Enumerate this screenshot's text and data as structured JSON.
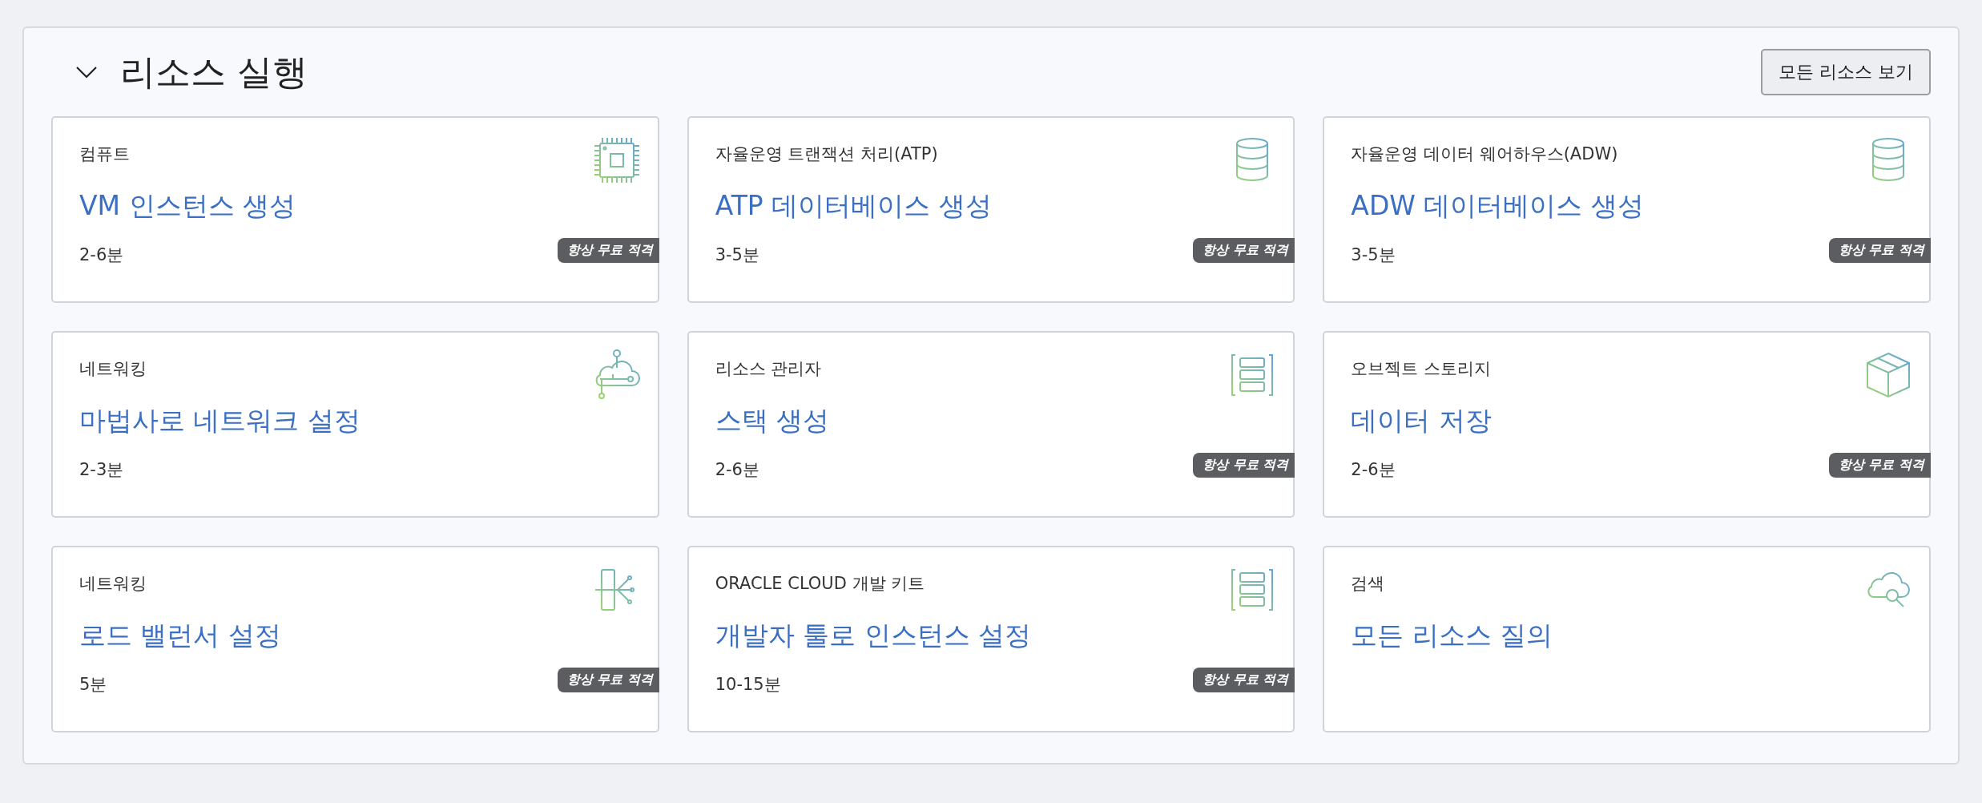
{
  "section": {
    "title": "리소스 실행",
    "expanded": true,
    "button": "모든 리소스 보기"
  },
  "cards": [
    {
      "category": "컴퓨트",
      "title": "VM 인스턴스 생성",
      "time": "2-6분",
      "kind": "chip",
      "badge": "항상 무료 적격"
    },
    {
      "category": "자율운영 트랜잭션 처리(ATP)",
      "title": "ATP 데이터베이스 생성",
      "time": "3-5분",
      "kind": "database",
      "badge": "항상 무료 적격"
    },
    {
      "category": "자율운영 데이터 웨어하우스(ADW)",
      "title": "ADW 데이터베이스 생성",
      "time": "3-5분",
      "kind": "database",
      "badge": "항상 무료 적격"
    },
    {
      "category": "네트워킹",
      "title": "마법사로 네트워크 설정",
      "time": "2-3분",
      "kind": "network"
    },
    {
      "category": "리소스 관리자",
      "title": "스택 생성",
      "time": "2-6분",
      "kind": "stack",
      "badge": "항상 무료 적격"
    },
    {
      "category": "오브젝트 스토리지",
      "title": "데이터 저장",
      "time": "2-6분",
      "kind": "box",
      "badge": "항상 무료 적격"
    },
    {
      "category": "네트워킹",
      "title": "로드 밸런서 설정",
      "time": "5분",
      "kind": "balancer",
      "badge": "항상 무료 적격"
    },
    {
      "category": "ORACLE CLOUD 개발 키트",
      "title": "개발자 툴로 인스턴스 설정",
      "time": "10-15분",
      "kind": "stack",
      "badge": "항상 무료 적격"
    },
    {
      "category": "검색",
      "title": "모든 리소스 질의",
      "kind": "search"
    }
  ]
}
